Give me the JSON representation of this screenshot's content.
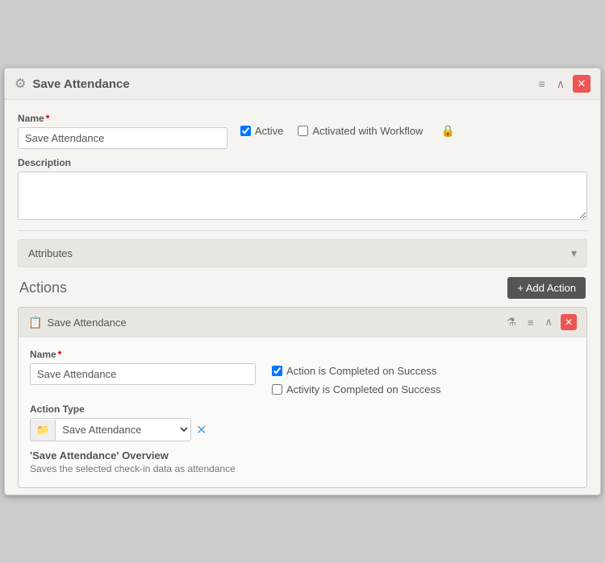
{
  "window": {
    "title": "Save Attendance",
    "icon": "⚙"
  },
  "toolbar": {
    "menu_icon": "≡",
    "up_icon": "∧",
    "close_icon": "✕"
  },
  "form": {
    "name_label": "Name",
    "name_value": "Save Attendance",
    "name_placeholder": "Name",
    "active_label": "Active",
    "activated_workflow_label": "Activated with Workflow",
    "description_label": "Description",
    "description_value": ""
  },
  "attributes": {
    "label": "Attributes",
    "chevron": "▾"
  },
  "actions": {
    "title": "Actions",
    "add_button_label": "+ Add Action",
    "card": {
      "title": "Save Attendance",
      "icon": "📋",
      "name_label": "Name",
      "name_value": "Save Attendance",
      "name_placeholder": "Name",
      "checkbox1_label": "Action is Completed on Success",
      "checkbox1_checked": true,
      "checkbox2_label": "Activity is Completed on Success",
      "checkbox2_checked": false,
      "action_type_label": "Action Type",
      "action_type_value": "Save Attendance",
      "overview_title": "'Save Attendance' Overview",
      "overview_desc": "Saves the selected check-in data as attendance"
    }
  }
}
